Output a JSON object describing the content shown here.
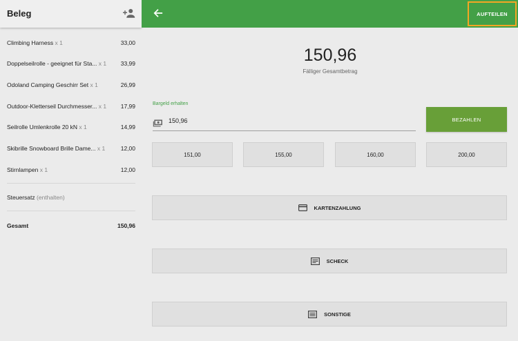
{
  "receipt": {
    "title": "Beleg",
    "add_person_icon": "add-person-icon",
    "items": [
      {
        "name": "Climbing Harness",
        "qty": "x 1",
        "price": "33,00"
      },
      {
        "name": "Doppelseilrolle - geeignet für Sta...",
        "qty": "x 1",
        "price": "33,99"
      },
      {
        "name": "Odoland Camping Geschirr Set",
        "qty": "x 1",
        "price": "26,99"
      },
      {
        "name": "Outdoor-Kletterseil Durchmesser...",
        "qty": "x 1",
        "price": "17,99"
      },
      {
        "name": "Seilrolle Umlenkrolle 20 kN",
        "qty": "x 1",
        "price": "14,99"
      },
      {
        "name": "Skibrille Snowboard Brille Dame...",
        "qty": "x 1",
        "price": "12,00"
      },
      {
        "name": "Stirnlampen",
        "qty": "x 1",
        "price": "12,00"
      }
    ],
    "tax_label": "Steuersatz",
    "tax_note": "(enthalten)",
    "total_label": "Gesamt",
    "total_value": "150,96"
  },
  "topbar": {
    "back_icon": "arrow-left-icon",
    "split_label": "AUFTEILEN",
    "color": "#43a047"
  },
  "payment": {
    "amount": "150,96",
    "amount_caption": "Fälliger Gesamtbetrag",
    "cash_label": "Bargeld erhalten",
    "cash_value": "150,96",
    "cash_icon": "cash-icon",
    "pay_label": "BEZAHLEN",
    "pay_color": "#689f38",
    "quick_amounts": [
      "151,00",
      "155,00",
      "160,00",
      "200,00"
    ],
    "methods": [
      {
        "label": "KARTENZAHLUNG",
        "icon": "credit-card-icon"
      },
      {
        "label": "SCHECK",
        "icon": "check-doc-icon"
      },
      {
        "label": "SONSTIGE",
        "icon": "other-doc-icon"
      }
    ]
  }
}
